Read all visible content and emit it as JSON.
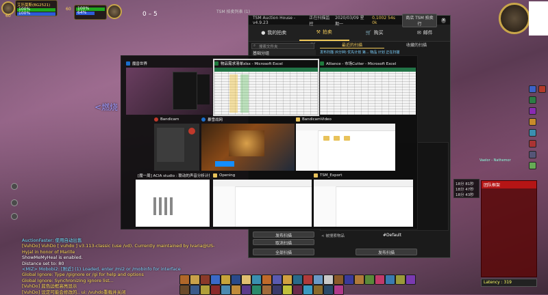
{
  "game": {
    "player_name": "艾历莫斯(BG2521)",
    "player_hp": "100%",
    "player_mana": "100%",
    "target_level": "60",
    "target_hp": "100%",
    "target_mana": "64%",
    "score": "0 – 5",
    "floating_name": "<燃烧",
    "player_plate": "Vaelor - Nathemor",
    "latency": "Latency : 319",
    "raid_header": "团队框架",
    "colors": {
      "hp": "#1fa81f",
      "mana": "#2d5bd8",
      "gold": "#c9a64a",
      "raid": "#8c0c0c"
    }
  },
  "tsm": {
    "window_title": "TSM 拍卖列表 (1)",
    "header": [
      "TSM Auction House - v4.9.23",
      "正在扫描监控",
      "2020/03/09 星期一",
      "0,1002 54s 0k"
    ],
    "header_button": "商店 TSM 拍卖行",
    "nav": [
      {
        "label": "我的拍卖",
        "icon": "person-icon"
      },
      {
        "label": "拍卖",
        "icon": "gavel-icon",
        "active": true
      },
      {
        "label": "购买",
        "icon": "cart-icon"
      },
      {
        "label": "邮件",
        "icon": "mail-icon"
      }
    ],
    "search_placeholder": "搜索文件夹",
    "group_label": "基础分组",
    "tabs": [
      "最近的扫描",
      "收藏的扫描"
    ],
    "scan_row": "发布扫描 (6分钟) 优先计划 第... 物品 计划 正在扫描",
    "bottom_buttons": [
      "发布扫描",
      "取消扫描",
      "全部扫描"
    ],
    "default_label": "#Default",
    "footer_left": "< 被搜索物品",
    "footer_right": "发布扫描"
  },
  "switcher": {
    "windows": [
      {
        "title": "魔兽世界",
        "icon_color": "#1a6ecb",
        "kind": "wow"
      },
      {
        "title": "物品需求清单xlsx - Microsoft Excel",
        "icon_color": "#1f7a3d",
        "kind": "excel",
        "selected": true
      },
      {
        "title": "Alliance - 市场Cutter - Microsoft Excel",
        "icon_color": "#1f7a3d",
        "kind": "excel2"
      },
      {
        "title": "Bandicam",
        "icon_color": "#c0392b",
        "kind": "bandicam"
      },
      {
        "title": "暴雪战网",
        "icon_color": "#1a6ecb",
        "kind": "battlenet"
      },
      {
        "title": "BandicamVideo",
        "icon_color": "#e8c25a",
        "kind": "explorer"
      },
      {
        "title": "[魔一周] ACIA studio : 联动的声音分析计播 ...",
        "icon_color": "#3a7bd5",
        "kind": "browser"
      },
      {
        "title": "Opening",
        "icon_color": "#e8c25a",
        "kind": "explorer"
      },
      {
        "title": "TSM_Export",
        "icon_color": "#e8c25a",
        "kind": "explorer"
      }
    ]
  },
  "chat": [
    {
      "text": "AuctionFaster: 使用自动出售",
      "color": "#6fe3ff"
    },
    {
      "text": "[VuhDo] VuhDo [ vuhdo ] v3.113-classic (use /vd). Currently maintained by Ivaria@US-",
      "color": "#ffdd55"
    },
    {
      "text": "    Hyjal in honor of Marille",
      "color": "#ffdd55"
    },
    {
      "text": "ShowMeMyHeal is enabled.",
      "color": "#ffffff"
    },
    {
      "text": "Distance set to: 80",
      "color": "#ffffff"
    },
    {
      "text": "<MIZ> Mobobi2: [附近] (1) Loaded, enter /mi2 or /mobinfo for interface",
      "color": "#7bd7ff"
    },
    {
      "text": "Global Ignore: Type /gignore or /gi for help and options",
      "color": "#ffdd55"
    },
    {
      "text": "Global Ignore: Synchronizing ignore list...",
      "color": "#ffdd55"
    },
    {
      "text": "[VuhDo] 蓝色边框高亮显示",
      "color": "#ffdd55"
    },
    {
      "text": "[VuhDo] 设定可能会修改的.. ui: /vuhdo重载并关闭",
      "color": "#ffdd55"
    }
  ],
  "meter": {
    "lines": [
      "18分 81秒",
      "18分 47秒",
      "18分 43秒"
    ]
  }
}
